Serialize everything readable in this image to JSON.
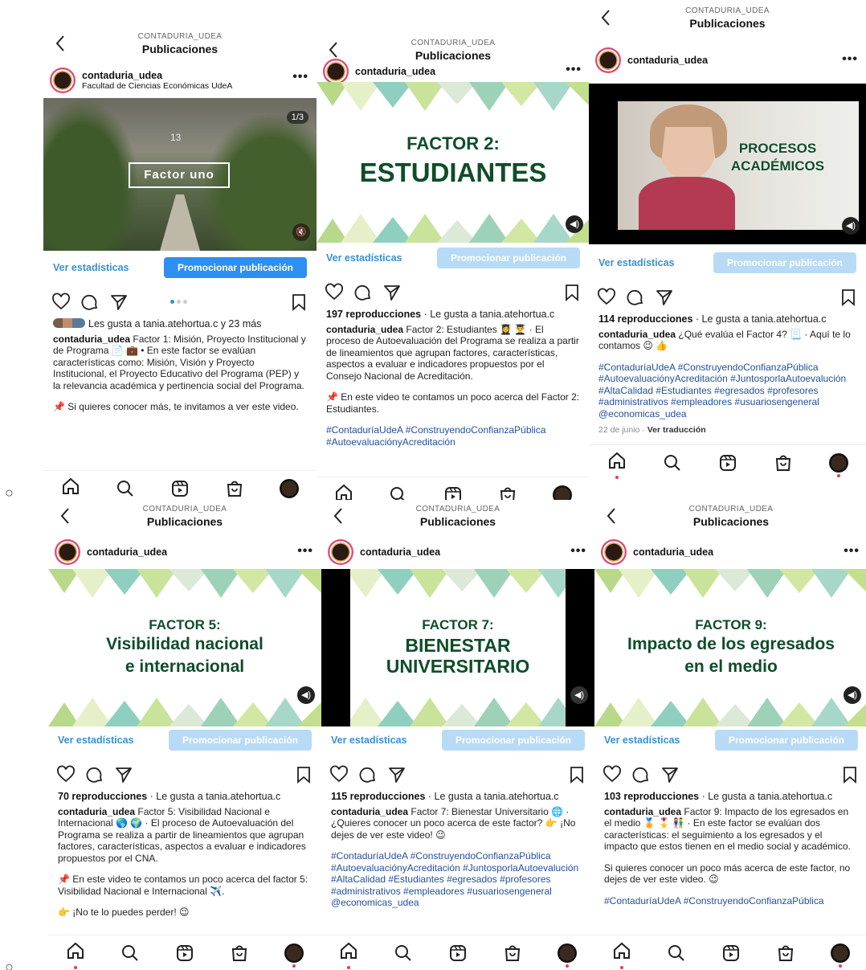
{
  "bullets": [
    "○",
    "○"
  ],
  "screens": [
    {
      "header": {
        "account": "CONTADURIA_UDEA",
        "title": "Publicaciones"
      },
      "user": {
        "name": "contaduria_udea",
        "subtitle": "Facultad de Ciencias Económicas UdeA"
      },
      "media": {
        "type": "photo",
        "overlay": "Factor uno",
        "counter": "1/3",
        "sign": "13"
      },
      "stats_link": "Ver estadísticas",
      "promote": "Promocionar publicación",
      "likes_line": "Les gusta a tania.atehortua.c y 23 más",
      "caption_user": "contaduria_udea",
      "caption": "Factor 1: Misión, Proyecto Institucional y de Programa 📄 💼 • En este factor se evalúan características como: Misión, Visión y Proyecto Institucional, el Proyecto Educativo del Programa (PEP) y la relevancia académica y pertinencia social del Programa.",
      "extra": "📌 Si quieres conocer más, te invitamos a ver este video.",
      "tags": ""
    },
    {
      "header": {
        "account": "CONTADURIA_UDEA",
        "title": "Publicaciones"
      },
      "user": {
        "name": "contaduria_udea",
        "subtitle": ""
      },
      "media": {
        "type": "card",
        "line1": "FACTOR 2:",
        "line2": "ESTUDIANTES"
      },
      "stats_link": "Ver estadísticas",
      "promote": "Promocionar publicación",
      "views": "197 reproducciones",
      "likes_by": " · Le gusta a tania.atehortua.c",
      "caption_user": "contaduria_udea",
      "caption": "Factor 2: Estudiantes 👩‍🎓 👨‍🎓 · El proceso de Autoevaluación del Programa se realiza a partir de lineamientos que agrupan factores, características, aspectos a evaluar e indicadores propuestos por el Consejo Nacional de Acreditación.",
      "extra": "📌 En este video te contamos un poco acerca del Factor 2: Estudiantes.",
      "tags": "#ContaduríaUdeA #ConstruyendoConfianzaPública #AutoevaluaciónyAcreditación"
    },
    {
      "header": {
        "account": "CONTADURIA_UDEA",
        "title": "Publicaciones"
      },
      "user": {
        "name": "contaduria_udea",
        "subtitle": ""
      },
      "media": {
        "type": "video",
        "line1": "PROCESOS",
        "line2": "ACADÉMICOS"
      },
      "stats_link": "Ver estadísticas",
      "promote": "Promocionar publicación",
      "views": "114 reproducciones",
      "likes_by": " · Le gusta a tania.atehortua.c",
      "caption_user": "contaduria_udea",
      "caption": "¿Qué evalúa el Factor 4? 📃 · Aquí te lo contamos 😉 👍",
      "extra": "",
      "tags": "#ContaduríaUdeA #ConstruyendoConfianzaPública #AutoevaluaciónyAcreditación #JuntosporlaAutoevalución #AltaCalidad #Estudiantes #egresados #profesores #administrativos #empleadores #usuariosengeneral @economicas_udea",
      "date": "22 de junio",
      "translate": "Ver traducción"
    },
    {
      "header": {
        "account": "CONTADURIA_UDEA",
        "title": "Publicaciones"
      },
      "user": {
        "name": "contaduria_udea",
        "subtitle": ""
      },
      "media": {
        "type": "card",
        "line1": "FACTOR 5:",
        "line2": "Visibilidad nacional",
        "line3": "e internacional"
      },
      "stats_link": "Ver estadísticas",
      "promote": "Promocionar publicación",
      "views": "70 reproducciones",
      "likes_by": " · Le gusta a tania.atehortua.c",
      "caption_user": "contaduria_udea",
      "caption": "Factor 5: Visibilidad Nacional e Internacional 🌎 🌍 · El proceso de Autoevaluación del Programa se realiza a partir de lineamientos que agrupan factores, características, aspectos a evaluar e indicadores propuestos por el CNA.",
      "extra": "📌 En este video te contamos un poco acerca del factor 5: Visibilidad Nacional e Internacional ✈️.",
      "extra2": "👉 ¡No te lo puedes perder! 😉",
      "tags": ""
    },
    {
      "header": {
        "account": "CONTADURIA_UDEA",
        "title": "Publicaciones"
      },
      "user": {
        "name": "contaduria_udea",
        "subtitle": ""
      },
      "media": {
        "type": "card-dark",
        "line1": "FACTOR 7:",
        "line2": "BIENESTAR",
        "line3": "UNIVERSITARIO"
      },
      "stats_link": "Ver estadísticas",
      "promote": "Promocionar publicación",
      "views": "115 reproducciones",
      "likes_by": " · Le gusta a tania.atehortua.c",
      "caption_user": "contaduria_udea",
      "caption": "Factor 7: Bienestar Universitario 🌐 · ¿Quieres conocer un poco acerca de este factor? 👉 ¡No dejes de ver este video! 😉",
      "extra": "",
      "tags": "#ContaduríaUdeA #ConstruyendoConfianzaPública #AutoevaluaciónyAcreditación #JuntosporlaAutoevalución #AltaCalidad #Estudiantes #egresados #profesores #administrativos #empleadores #usuariosengeneral @economicas_udea"
    },
    {
      "header": {
        "account": "CONTADURIA_UDEA",
        "title": "Publicaciones"
      },
      "user": {
        "name": "contaduria_udea",
        "subtitle": ""
      },
      "media": {
        "type": "card",
        "line1": "FACTOR 9:",
        "line2": "Impacto de los egresados",
        "line3": "en el medio"
      },
      "stats_link": "Ver estadísticas",
      "promote": "Promocionar publicación",
      "views": "103 reproducciones",
      "likes_by": " · Le gusta a tania.atehortua.c",
      "caption_user": "contaduria_udea",
      "caption": "Factor 9: Impacto de los egresados en el medio 🏅 🎖️ 👫 · En este factor se evalúan dos características: el seguimiento a los egresados y el impacto que estos tienen en el medio social y académico.",
      "extra": "Si quieres conocer un poco más acerca de este factor, no dejes de ver este video. 😉",
      "tags": "#ContaduríaUdeA #ConstruyendoConfianzaPública"
    }
  ],
  "colors": {
    "link": "#3a8fd4",
    "promo_disabled": "#b7dbf6",
    "promo_active": "#2e8ff0",
    "card_green": "#0f4d2a",
    "hashtag": "#234f9c"
  }
}
